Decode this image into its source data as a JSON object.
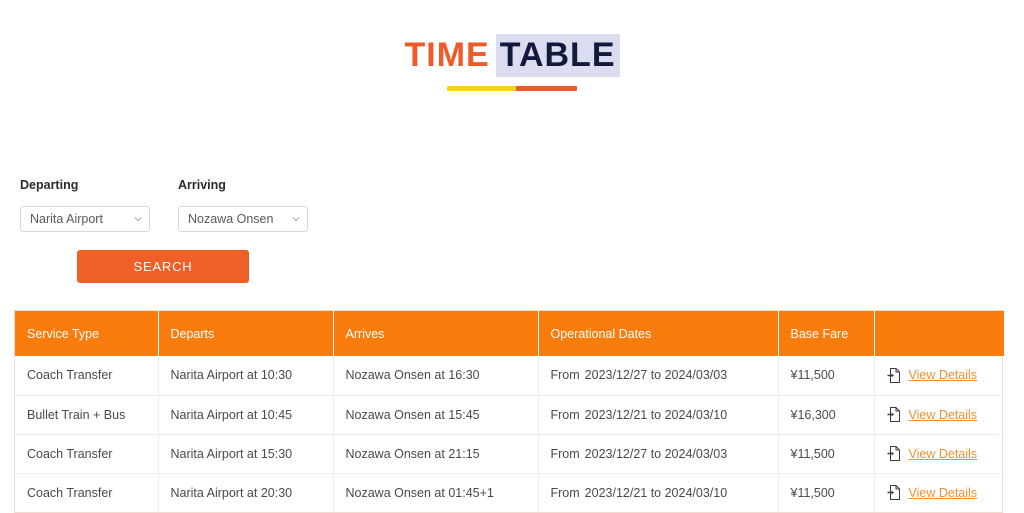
{
  "logo": {
    "part1": "TIME",
    "part2": "TABLE",
    "accent_orange": "#f05a28",
    "accent_navy": "#111a3d",
    "accent_yellow": "#fcd117",
    "highlight_bg": "#dcdcf0"
  },
  "search": {
    "departing_label": "Departing",
    "departing_value": "Narita Airport",
    "arriving_label": "Arriving",
    "arriving_value": "Nozawa Onsen",
    "button_label": "SEARCH",
    "button_color": "#ef5f28",
    "chevron_icon": "chevron-down-icon"
  },
  "table": {
    "header_color": "#f97c0c",
    "link_color": "#f0912b",
    "columns": [
      "Service Type",
      "Departs",
      "Arrives",
      "Operational Dates",
      "Base Fare",
      ""
    ],
    "rows": [
      {
        "service": "Coach Transfer",
        "departs": "Narita Airport at 10:30",
        "arrives": "Nozawa Onsen at 16:30",
        "dates_prefix": "From",
        "dates": "2023/12/27 to 2024/03/03",
        "fare": "¥11,500",
        "action": "View Details",
        "action_icon": "file-import-icon"
      },
      {
        "service": "Bullet Train + Bus",
        "departs": "Narita Airport at 10:45",
        "arrives": "Nozawa Onsen at 15:45",
        "dates_prefix": "From",
        "dates": "2023/12/21 to 2024/03/10",
        "fare": "¥16,300",
        "action": "View Details",
        "action_icon": "file-import-icon"
      },
      {
        "service": "Coach Transfer",
        "departs": "Narita Airport at 15:30",
        "arrives": "Nozawa Onsen at 21:15",
        "dates_prefix": "From",
        "dates": "2023/12/27 to 2024/03/03",
        "fare": "¥11,500",
        "action": "View Details",
        "action_icon": "file-import-icon"
      },
      {
        "service": "Coach Transfer",
        "departs": "Narita Airport at 20:30",
        "arrives": "Nozawa Onsen at 01:45+1",
        "dates_prefix": "From",
        "dates": "2023/12/21 to 2024/03/10",
        "fare": "¥11,500",
        "action": "View Details",
        "action_icon": "file-import-icon"
      }
    ]
  }
}
